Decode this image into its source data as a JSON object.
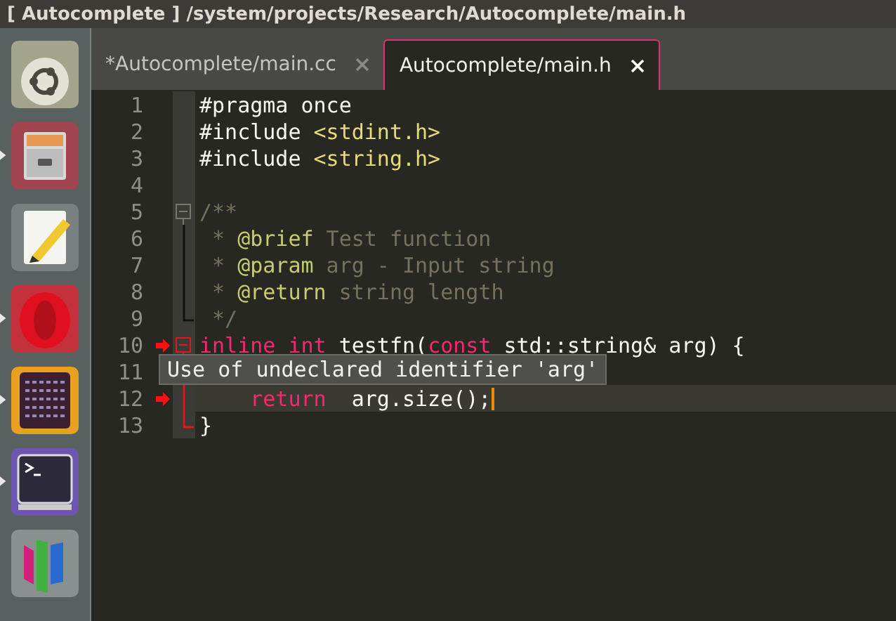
{
  "window": {
    "title": "[ Autocomplete ] /system/projects/Research/Autocomplete/main.h"
  },
  "launcher": [
    {
      "kind": "ubuntu"
    },
    {
      "kind": "files",
      "running": true
    },
    {
      "kind": "notes"
    },
    {
      "kind": "browser",
      "running": true
    },
    {
      "kind": "calculator",
      "running": true
    },
    {
      "kind": "terminal",
      "running": true
    },
    {
      "kind": "monitor"
    }
  ],
  "tabs": [
    {
      "label": "*Autocomplete/main.cc",
      "selected": false
    },
    {
      "label": "Autocomplete/main.h",
      "selected": true
    }
  ],
  "editor": {
    "lines": [
      {
        "number": "1",
        "tokens": [
          {
            "kind": "plain",
            "text": "#pragma once"
          }
        ]
      },
      {
        "number": "2",
        "tokens": [
          {
            "kind": "plain",
            "text": "#include "
          },
          {
            "kind": "string",
            "text": "<stdint.h>"
          }
        ]
      },
      {
        "number": "3",
        "tokens": [
          {
            "kind": "plain",
            "text": "#include "
          },
          {
            "kind": "string",
            "text": "<string.h>"
          }
        ]
      },
      {
        "number": "4"
      },
      {
        "number": "5",
        "fold_start": true,
        "tokens": [
          {
            "kind": "comment",
            "text": "/**"
          }
        ]
      },
      {
        "number": "6",
        "fold_inside": true,
        "tokens": [
          {
            "kind": "comment",
            "text": " * "
          },
          {
            "kind": "doctag",
            "text": "@brief"
          },
          {
            "kind": "comment",
            "text": " Test function"
          }
        ]
      },
      {
        "number": "7",
        "fold_inside": true,
        "tokens": [
          {
            "kind": "comment",
            "text": " * "
          },
          {
            "kind": "doctag",
            "text": "@param"
          },
          {
            "kind": "comment",
            "text": " arg - Input string"
          }
        ]
      },
      {
        "number": "8",
        "fold_inside": true,
        "tokens": [
          {
            "kind": "comment",
            "text": " * "
          },
          {
            "kind": "doctag",
            "text": "@return"
          },
          {
            "kind": "comment",
            "text": " string length"
          }
        ]
      },
      {
        "number": "9",
        "fold_end": true,
        "tokens": [
          {
            "kind": "comment",
            "text": " */"
          }
        ]
      },
      {
        "number": "10",
        "fold_start": true,
        "fold_error": true,
        "error": true,
        "tokens": [
          {
            "kind": "keyword",
            "text": "inline"
          },
          {
            "kind": "keyword",
            "text": " int"
          },
          {
            "kind": "plain",
            "text": " testfn("
          },
          {
            "kind": "keyword",
            "text": "const"
          },
          {
            "kind": "plain",
            "text": " std::string& arg) {"
          }
        ]
      },
      {
        "number": "11"
      },
      {
        "number": "12",
        "fold_inside": true,
        "fold_error": true,
        "error": true,
        "current": true,
        "cursor": true,
        "tokens": [
          {
            "kind": "keyword",
            "text": "    return"
          },
          {
            "kind": "plain",
            "text": "  arg.size();"
          }
        ]
      },
      {
        "number": "13",
        "fold_end": true,
        "fold_error": true,
        "tokens": [
          {
            "kind": "plain",
            "text": "}"
          }
        ]
      }
    ],
    "tooltip": "Use of undeclared identifier 'arg'"
  }
}
